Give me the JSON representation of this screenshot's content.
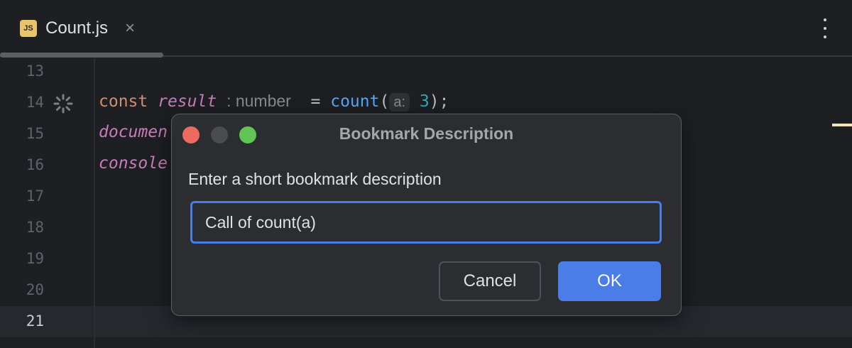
{
  "tab": {
    "icon_label": "JS",
    "name": "Count.js",
    "close": "×"
  },
  "editor": {
    "line_numbers": [
      "13",
      "14",
      "15",
      "16",
      "17",
      "18",
      "19",
      "20",
      "21"
    ],
    "code": {
      "kw": "const",
      "var": "result",
      "type_hint": ": number",
      "eq": " = ",
      "fn": "count",
      "open": "(",
      "param_hint": "a:",
      "arg": "3",
      "close": ");",
      "line15": "documen",
      "line16": "console"
    }
  },
  "dialog": {
    "title": "Bookmark Description",
    "label": "Enter a short bookmark description",
    "input_value": "Call of count(a)",
    "cancel": "Cancel",
    "ok": "OK"
  },
  "colors": {
    "accent": "#4a7de8",
    "close": "#ed6a5e",
    "minimize": "#4b4c4f",
    "zoom": "#61c554"
  }
}
